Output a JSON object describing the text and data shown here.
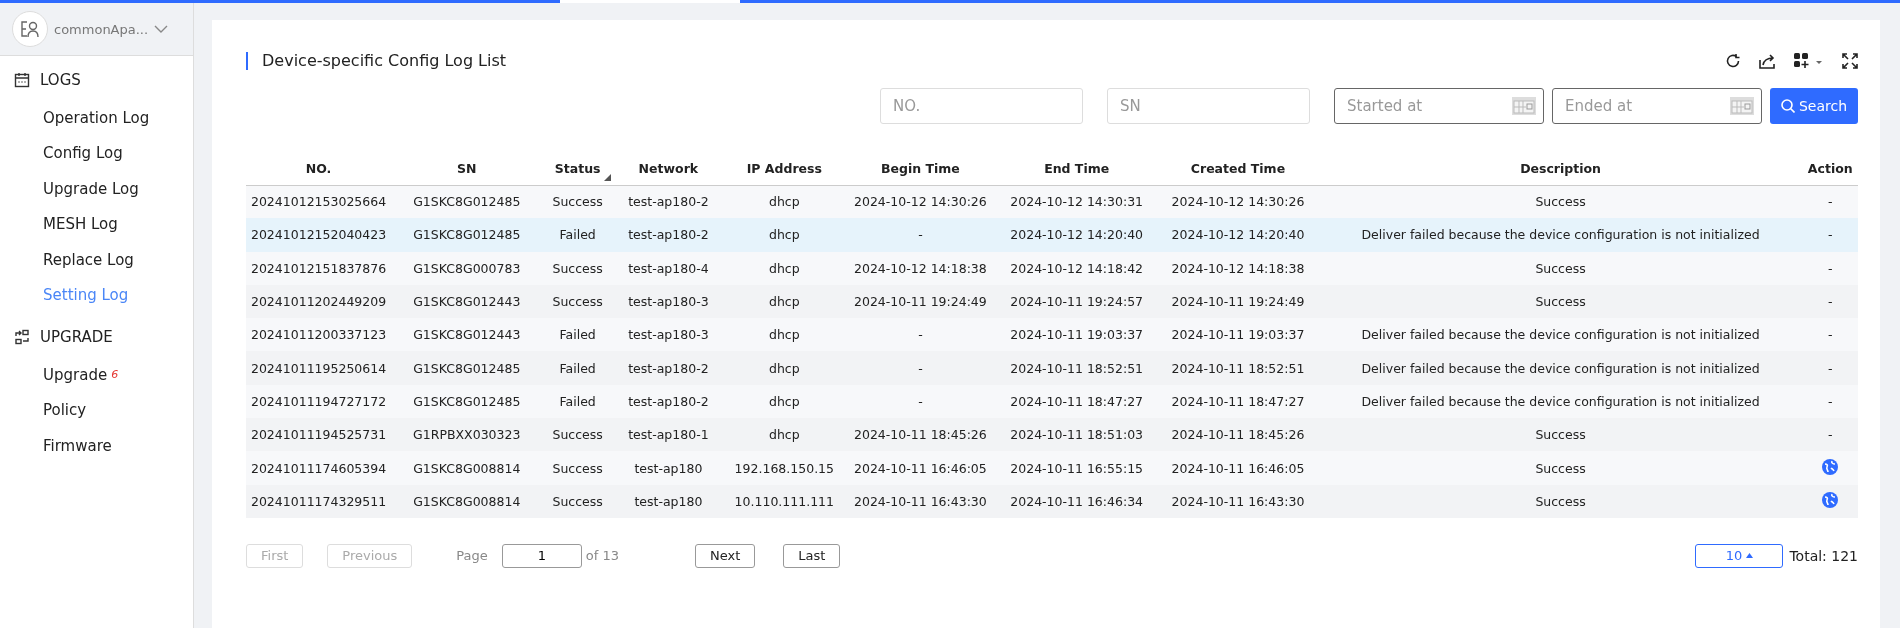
{
  "account": {
    "name": "commonApa..."
  },
  "sidebar": {
    "groups": [
      {
        "kind": "logs",
        "title": "LOGS",
        "items": [
          {
            "label": "Operation Log",
            "selected": false
          },
          {
            "label": "Config Log",
            "selected": false
          },
          {
            "label": "Upgrade Log",
            "selected": false
          },
          {
            "label": "MESH Log",
            "selected": false
          },
          {
            "label": "Replace Log",
            "selected": false
          },
          {
            "label": "Setting Log",
            "selected": true
          }
        ]
      },
      {
        "kind": "upgrade",
        "title": "UPGRADE",
        "items": [
          {
            "label": "Upgrade",
            "selected": false,
            "badge": "6"
          },
          {
            "label": "Policy",
            "selected": false
          },
          {
            "label": "Firmware",
            "selected": false
          }
        ]
      }
    ]
  },
  "page": {
    "title": "Device-specific Config Log List"
  },
  "filters": [
    {
      "kind": "text",
      "placeholder": "NO."
    },
    {
      "kind": "text",
      "placeholder": "SN"
    },
    {
      "kind": "date",
      "placeholder": "Started at"
    },
    {
      "kind": "date",
      "placeholder": "Ended at"
    }
  ],
  "search_button": "Search",
  "table": {
    "columns": [
      {
        "label": "NO.",
        "sortable": false
      },
      {
        "label": "SN",
        "sortable": false
      },
      {
        "label": "Status",
        "sortable": true
      },
      {
        "label": "Network",
        "sortable": false
      },
      {
        "label": "IP Address",
        "sortable": false
      },
      {
        "label": "Begin Time",
        "sortable": false
      },
      {
        "label": "End Time",
        "sortable": false
      },
      {
        "label": "Created Time",
        "sortable": false
      },
      {
        "label": "Description",
        "sortable": false
      },
      {
        "label": "Action",
        "sortable": false
      }
    ],
    "rows": [
      {
        "selected": false,
        "cells": [
          "20241012153025664",
          "G1SKC8G012485",
          "Success",
          "test-ap180-2",
          "dhcp",
          "2024-10-12 14:30:26",
          "2024-10-12 14:30:31",
          "2024-10-12 14:30:26",
          "Success"
        ],
        "action": {
          "kind": "text",
          "text": "-"
        }
      },
      {
        "selected": true,
        "cells": [
          "20241012152040423",
          "G1SKC8G012485",
          "Failed",
          "test-ap180-2",
          "dhcp",
          "-",
          "2024-10-12 14:20:40",
          "2024-10-12 14:20:40",
          "Deliver failed because the device configuration is not initialized"
        ],
        "action": {
          "kind": "text",
          "text": "-"
        }
      },
      {
        "selected": false,
        "cells": [
          "20241012151837876",
          "G1SKC8G000783",
          "Success",
          "test-ap180-4",
          "dhcp",
          "2024-10-12 14:18:38",
          "2024-10-12 14:18:42",
          "2024-10-12 14:18:38",
          "Success"
        ],
        "action": {
          "kind": "text",
          "text": "-"
        }
      },
      {
        "selected": false,
        "cells": [
          "20241011202449209",
          "G1SKC8G012443",
          "Success",
          "test-ap180-3",
          "dhcp",
          "2024-10-11 19:24:49",
          "2024-10-11 19:24:57",
          "2024-10-11 19:24:49",
          "Success"
        ],
        "action": {
          "kind": "text",
          "text": "-"
        }
      },
      {
        "selected": false,
        "cells": [
          "20241011200337123",
          "G1SKC8G012443",
          "Failed",
          "test-ap180-3",
          "dhcp",
          "-",
          "2024-10-11 19:03:37",
          "2024-10-11 19:03:37",
          "Deliver failed because the device configuration is not initialized"
        ],
        "action": {
          "kind": "text",
          "text": "-"
        }
      },
      {
        "selected": false,
        "cells": [
          "20241011195250614",
          "G1SKC8G012485",
          "Failed",
          "test-ap180-2",
          "dhcp",
          "-",
          "2024-10-11 18:52:51",
          "2024-10-11 18:52:51",
          "Deliver failed because the device configuration is not initialized"
        ],
        "action": {
          "kind": "text",
          "text": "-"
        }
      },
      {
        "selected": false,
        "cells": [
          "20241011194727172",
          "G1SKC8G012485",
          "Failed",
          "test-ap180-2",
          "dhcp",
          "-",
          "2024-10-11 18:47:27",
          "2024-10-11 18:47:27",
          "Deliver failed because the device configuration is not initialized"
        ],
        "action": {
          "kind": "text",
          "text": "-"
        }
      },
      {
        "selected": false,
        "cells": [
          "20241011194525731",
          "G1RPBXX030323",
          "Success",
          "test-ap180-1",
          "dhcp",
          "2024-10-11 18:45:26",
          "2024-10-11 18:51:03",
          "2024-10-11 18:45:26",
          "Success"
        ],
        "action": {
          "kind": "text",
          "text": "-"
        }
      },
      {
        "selected": false,
        "cells": [
          "20241011174605394",
          "G1SKC8G008814",
          "Success",
          "test-ap180",
          "192.168.150.15",
          "2024-10-11 16:46:05",
          "2024-10-11 16:55:15",
          "2024-10-11 16:46:05",
          "Success"
        ],
        "action": {
          "kind": "globe"
        }
      },
      {
        "selected": false,
        "cells": [
          "20241011174329511",
          "G1SKC8G008814",
          "Success",
          "test-ap180",
          "10.110.111.111",
          "2024-10-11 16:43:30",
          "2024-10-11 16:46:34",
          "2024-10-11 16:43:30",
          "Success"
        ],
        "action": {
          "kind": "globe"
        }
      }
    ]
  },
  "pagination": {
    "first": {
      "label": "First",
      "disabled": true
    },
    "previous": {
      "label": "Previous",
      "disabled": true
    },
    "page_label": "Page",
    "page": "1",
    "of": "of 13",
    "next": {
      "label": "Next",
      "disabled": false
    },
    "last": {
      "label": "Last",
      "disabled": false
    },
    "page_size": "10",
    "total": "Total: 121"
  }
}
